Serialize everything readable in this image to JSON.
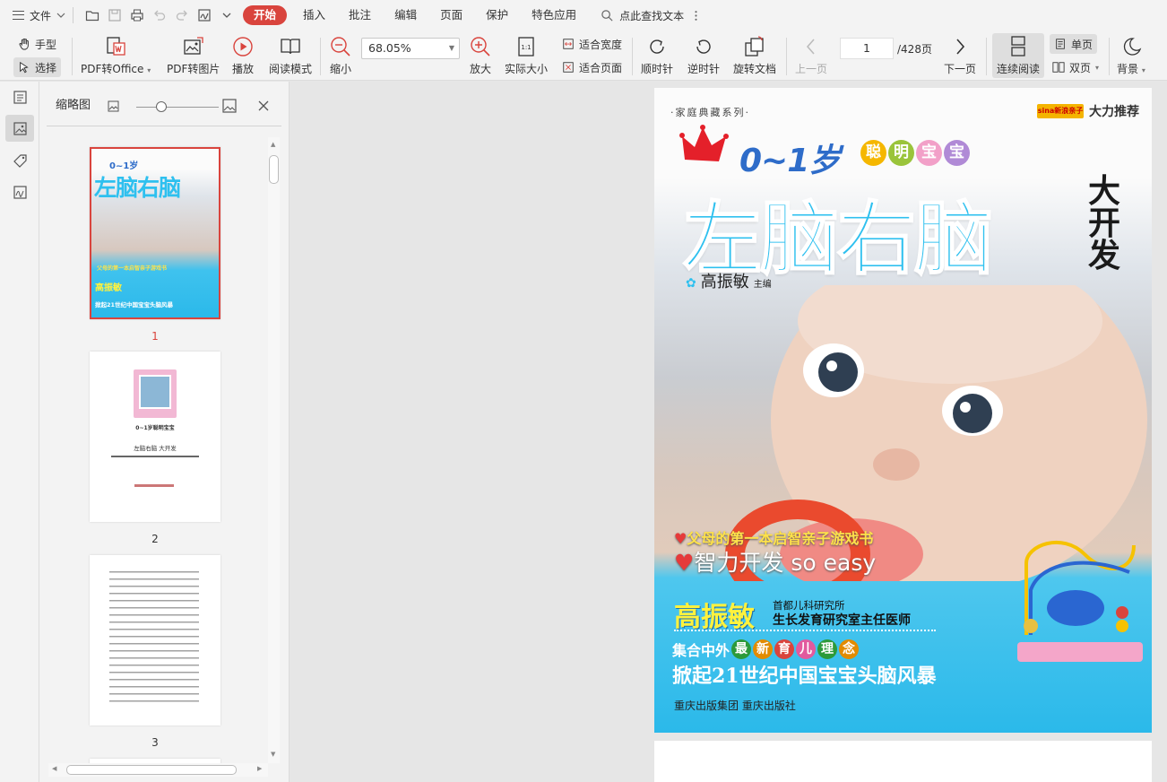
{
  "menubar": {
    "file_label": "文件",
    "tabs": [
      "开始",
      "插入",
      "批注",
      "编辑",
      "页面",
      "保护",
      "特色应用"
    ],
    "find_label": "点此查找文本"
  },
  "toolbar": {
    "hand": "手型",
    "select": "选择",
    "pdf_to_office": "PDF转Office",
    "pdf_to_image": "PDF转图片",
    "play": "播放",
    "read_mode": "阅读模式",
    "zoom_out": "缩小",
    "zoom_value": "68.05%",
    "zoom_in": "放大",
    "actual_size": "实际大小",
    "fit_width": "适合宽度",
    "fit_page": "适合页面",
    "rotate_cw": "顺时针",
    "rotate_ccw": "逆时针",
    "rotate_doc": "旋转文档",
    "prev_page": "上一页",
    "page_current": "1",
    "page_total": "/428页",
    "next_page": "下一页",
    "continuous": "连续阅读",
    "single": "单页",
    "double": "双页",
    "background": "背景",
    "actual_size_icon_text": "1:1"
  },
  "thumbnails": {
    "title": "缩略图",
    "pages": [
      "1",
      "2",
      "3"
    ]
  },
  "thumb2": {
    "line1": "0~1岁聪明宝宝",
    "line2": "左脑右脑 大开发"
  },
  "cover": {
    "series": "·家庭典藏系列·",
    "recommend": "大力推荐",
    "logo": "sina新浪亲子",
    "age": "0~1岁",
    "smart_chars": [
      "聪",
      "明",
      "宝",
      "宝"
    ],
    "main_title": "左脑右脑",
    "big_dev": "大开发",
    "author": "高振敏",
    "editor_role": "主编",
    "tagline1": "父母的第一本启智亲子游戏书",
    "tagline2": "智力开发 so easy",
    "author_name": "高振敏",
    "institution1": "首都儿科研究所",
    "institution2": "生长发育研究室主任医师",
    "collect_prefix": "集合中外",
    "collect_chars": [
      "最",
      "新",
      "育",
      "儿",
      "理",
      "念"
    ],
    "storm": "掀起21世纪中国宝宝头脑风暴",
    "publisher": "重庆出版集团 重庆出版社"
  },
  "colors": {
    "accent": "#d9443d",
    "cover_blue": "#2ec0ef"
  }
}
